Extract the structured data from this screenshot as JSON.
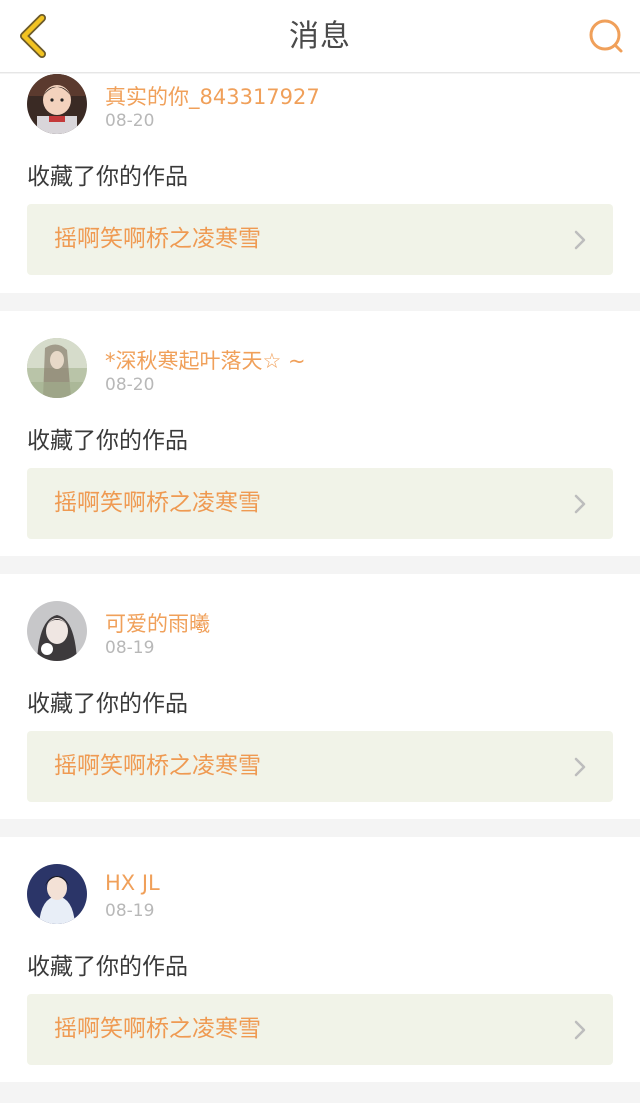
{
  "header": {
    "title": "消息",
    "back_icon": "chevron-left-icon",
    "search_icon": "search-icon",
    "accent_color": "#f0a05a"
  },
  "notifications": [
    {
      "username": "真实的你_843317927",
      "date": "08-20",
      "action": "收藏了你的作品",
      "work_title": "摇啊笑啊桥之凌寒雪"
    },
    {
      "username": "*深秋寒起叶落天☆ ~",
      "date": "08-20",
      "action": "收藏了你的作品",
      "work_title": "摇啊笑啊桥之凌寒雪"
    },
    {
      "username": "可爱的雨曦",
      "date": "08-19",
      "action": "收藏了你的作品",
      "work_title": "摇啊笑啊桥之凌寒雪"
    },
    {
      "username": "HX JL",
      "date": "08-19",
      "action": "收藏了你的作品",
      "work_title": "摇啊笑啊桥之凌寒雪"
    }
  ]
}
